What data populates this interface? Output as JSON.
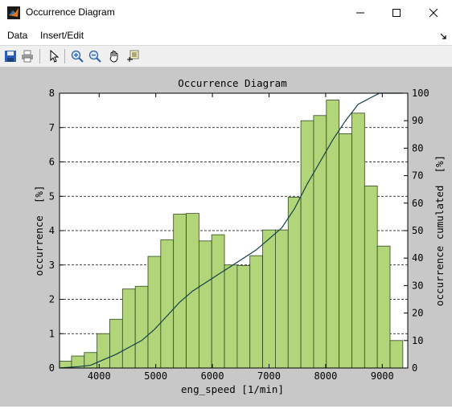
{
  "window": {
    "title": "Occurrence Diagram"
  },
  "menu": {
    "items": [
      "Data",
      "Insert/Edit"
    ]
  },
  "toolbar": {
    "icons": [
      "save-icon",
      "print-icon",
      "pointer-icon",
      "zoom-in-icon",
      "zoom-out-icon",
      "pan-icon",
      "data-cursor-icon"
    ]
  },
  "colors": {
    "bar_fill": "#b3d57a",
    "bar_edge": "#2e4a1f",
    "cum_line": "#123f4a",
    "figure_bg": "#c8c8c8"
  },
  "chart_data": {
    "type": "bar",
    "title": "Occurrence Diagram",
    "xlabel": "eng_speed [1/min]",
    "ylabel": "occurrence  [%]",
    "y2label": "occurrence cumulated  [%]",
    "xlim": [
      3300,
      9450
    ],
    "ylim": [
      0,
      8
    ],
    "y2lim": [
      0,
      100
    ],
    "xticks": [
      4000,
      5000,
      6000,
      7000,
      8000,
      9000
    ],
    "yticks": [
      0,
      1,
      2,
      3,
      4,
      5,
      6,
      7,
      8
    ],
    "y2ticks": [
      0,
      10,
      20,
      30,
      40,
      50,
      60,
      70,
      80,
      90,
      100
    ],
    "grid": "horizontal dashed",
    "bin_width": 225,
    "x": [
      3400,
      3625,
      3850,
      4075,
      4300,
      4525,
      4750,
      4975,
      5200,
      5425,
      5650,
      5875,
      6100,
      6325,
      6550,
      6775,
      7000,
      7225,
      7450,
      7675,
      7900,
      8125,
      8350,
      8575,
      8800,
      9025,
      9250
    ],
    "values": [
      0.2,
      0.35,
      0.45,
      1.0,
      1.42,
      2.3,
      2.38,
      3.25,
      3.73,
      4.48,
      4.5,
      3.7,
      3.88,
      3.0,
      2.98,
      3.27,
      4.02,
      4.02,
      4.97,
      7.2,
      7.35,
      7.8,
      6.82,
      7.42,
      5.3,
      3.55,
      0.8
    ],
    "cumulative": [
      0,
      0.5,
      1,
      3,
      5,
      7.5,
      10,
      14,
      19,
      24,
      28,
      31,
      34,
      37,
      40,
      43,
      47,
      51,
      58,
      67,
      75,
      83,
      90,
      96,
      100,
      100,
      100
    ],
    "cumulative_x": [
      3300,
      3625,
      3850,
      4075,
      4300,
      4525,
      4750,
      4975,
      5200,
      5425,
      5650,
      5875,
      6100,
      6325,
      6550,
      6775,
      7000,
      7225,
      7450,
      7675,
      7900,
      8125,
      8350,
      8575,
      8950,
      9200,
      9360
    ]
  }
}
